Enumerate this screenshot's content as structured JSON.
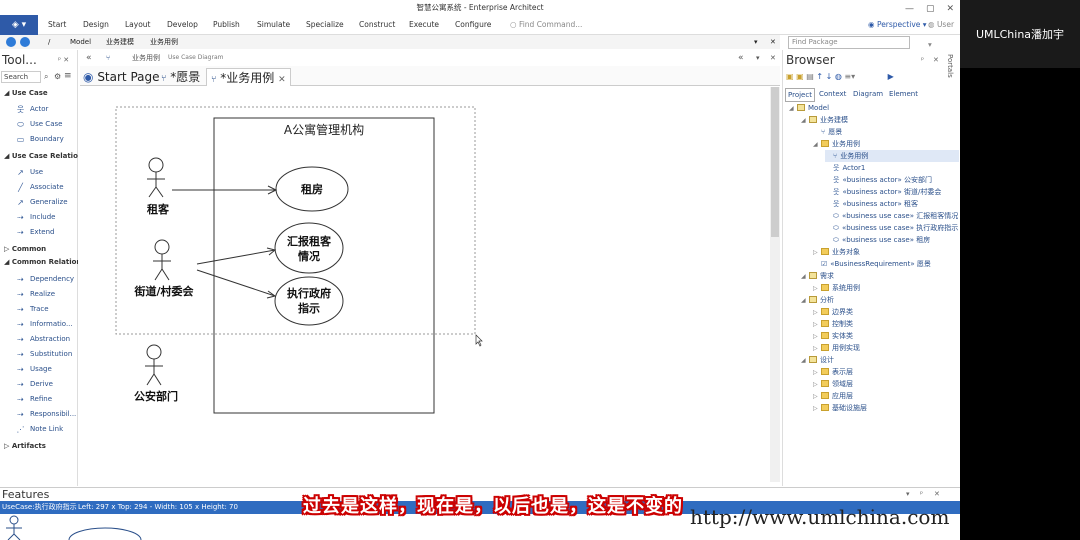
{
  "window": {
    "title": "智慧公寓系统 - Enterprise Architect",
    "controls": [
      "—",
      "▢",
      "✕"
    ]
  },
  "ribbon": {
    "menus": [
      "Start",
      "Design",
      "Layout",
      "Develop",
      "Publish",
      "Simulate",
      "Specialize",
      "Construct",
      "Execute",
      "Configure"
    ],
    "find_command": "Find Command...",
    "perspective": "Perspective",
    "user": "User"
  },
  "navbar": {
    "path": [
      "/",
      "Model",
      "业务建模",
      "业务用例"
    ]
  },
  "find_package": {
    "placeholder": "Find Package"
  },
  "toolbox": {
    "title": "Tool...",
    "search_placeholder": "Search",
    "sections": [
      {
        "header": "Use Case",
        "items": [
          "Actor",
          "Use Case",
          "Boundary"
        ]
      },
      {
        "header": "Use Case Relations",
        "items": [
          "Use",
          "Associate",
          "Generalize",
          "Include",
          "Extend"
        ]
      },
      {
        "header": "Common",
        "items": []
      },
      {
        "header": "Common Relations",
        "items": [
          "Dependency",
          "Realize",
          "Trace",
          "Informatio...",
          "Abstraction",
          "Substitution",
          "Usage",
          "Derive",
          "Refine",
          "Responsibil...",
          "Note Link"
        ]
      },
      {
        "header": "Artifacts",
        "items": []
      }
    ]
  },
  "diagram": {
    "header_name": "业务用例",
    "header_type": "Use Case Diagram",
    "tabs": [
      "Start Page",
      "*愿景",
      "*业务用例"
    ],
    "boundary_label": "A公寓管理机构",
    "actors": [
      "租客",
      "街道/村委会",
      "公安部门"
    ],
    "use_cases": [
      [
        "租房"
      ],
      [
        "汇报租客",
        "情况"
      ],
      [
        "执行政府",
        "指示"
      ]
    ]
  },
  "browser": {
    "title": "Browser",
    "tabs": [
      "Project",
      "Context",
      "Diagram",
      "Element"
    ],
    "portals_label": "Portals",
    "tree": [
      {
        "label": "Model",
        "level": 0,
        "icon": "pkg",
        "arrow": "◢"
      },
      {
        "label": "业务建模",
        "level": 1,
        "icon": "pkg",
        "arrow": "◢"
      },
      {
        "label": "愿景",
        "level": 2,
        "icon": "diag",
        "arrow": ""
      },
      {
        "label": "业务用例",
        "level": 2,
        "icon": "folder",
        "arrow": "◢"
      },
      {
        "label": "业务用例",
        "level": 3,
        "icon": "diag",
        "arrow": "",
        "selected": true
      },
      {
        "label": "Actor1",
        "level": 3,
        "icon": "actor",
        "arrow": ""
      },
      {
        "label": "«business actor» 公安部门",
        "level": 3,
        "icon": "actor",
        "arrow": ""
      },
      {
        "label": "«business actor» 街道/村委会",
        "level": 3,
        "icon": "actor",
        "arrow": ""
      },
      {
        "label": "«business actor» 租客",
        "level": 3,
        "icon": "actor",
        "arrow": ""
      },
      {
        "label": "«business use case» 汇报租客情况",
        "level": 3,
        "icon": "uc",
        "arrow": ""
      },
      {
        "label": "«business use case» 执行政府指示",
        "level": 3,
        "icon": "uc",
        "arrow": ""
      },
      {
        "label": "«business use case» 租房",
        "level": 3,
        "icon": "uc",
        "arrow": ""
      },
      {
        "label": "业务对象",
        "level": 2,
        "icon": "folder",
        "arrow": "▷"
      },
      {
        "label": "«BusinessRequirement» 愿景",
        "level": 2,
        "icon": "req",
        "arrow": ""
      },
      {
        "label": "需求",
        "level": 1,
        "icon": "pkg",
        "arrow": "◢"
      },
      {
        "label": "系统用例",
        "level": 2,
        "icon": "folder",
        "arrow": "▷"
      },
      {
        "label": "分析",
        "level": 1,
        "icon": "pkg",
        "arrow": "◢"
      },
      {
        "label": "边界类",
        "level": 2,
        "icon": "folder",
        "arrow": "▷"
      },
      {
        "label": "控制类",
        "level": 2,
        "icon": "folder",
        "arrow": "▷"
      },
      {
        "label": "实体类",
        "level": 2,
        "icon": "folder",
        "arrow": "▷"
      },
      {
        "label": "用例实现",
        "level": 2,
        "icon": "folder",
        "arrow": "▷"
      },
      {
        "label": "设计",
        "level": 1,
        "icon": "pkg",
        "arrow": "◢"
      },
      {
        "label": "表示层",
        "level": 2,
        "icon": "folder",
        "arrow": "▷"
      },
      {
        "label": "领域层",
        "level": 2,
        "icon": "folder",
        "arrow": "▷"
      },
      {
        "label": "应用层",
        "level": 2,
        "icon": "folder",
        "arrow": "▷"
      },
      {
        "label": "基础设施层",
        "level": 2,
        "icon": "folder",
        "arrow": "▷"
      }
    ]
  },
  "features": {
    "title": "Features"
  },
  "status": {
    "element": "UseCase:执行政府指示",
    "left": "Left:   297 x Top:   294 - Width:   105 x Height:   70"
  },
  "overlay": {
    "presenter": "UMLChina潘加宇",
    "subtitle": "过去是这样，现在是，以后也是，这是不变的",
    "watermark": "http://www.umlchina.com"
  },
  "colors": {
    "accent": "#2e5aa8",
    "statusbar": "#2f6cc0",
    "subtitle_outline": "#cc0000"
  }
}
